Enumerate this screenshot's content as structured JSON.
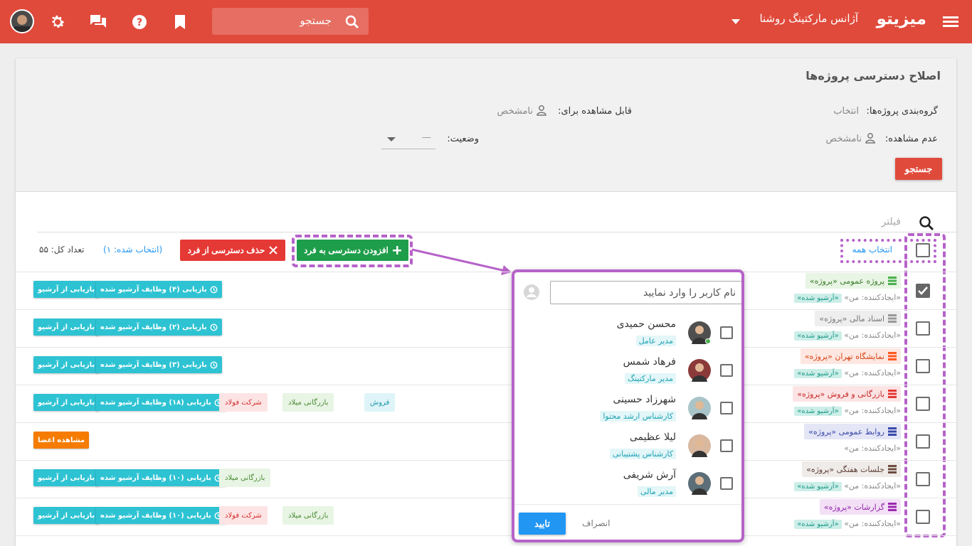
{
  "header": {
    "brand": "میزیتو",
    "agency": "آژانس مارکتینگ روشنا",
    "search_placeholder": "جستجو",
    "icons": [
      "menu-icon",
      "chevron-down-icon",
      "search-icon",
      "bookmark-icon",
      "help-icon",
      "chat-icon",
      "gear-icon",
      "avatar"
    ]
  },
  "filters": {
    "title": "اصلاح دسترسی پروژه‌ها",
    "grouping_label": "گروه‌بندی پروژه‌ها:",
    "grouping_value": "انتخاب",
    "viewable_label": "قابل مشاهده برای:",
    "viewable_value": "نامشخص",
    "not_viewable_label": "عدم مشاهده:",
    "not_viewable_value": "نامشخص",
    "status_label": "وضعیت:",
    "status_value": "—",
    "search_button": "جستجو"
  },
  "list": {
    "filter_placeholder": "فیلتر",
    "select_all": "انتخاب همه",
    "add_access": "افزودن دسترسی به فرد",
    "remove_access": "حذف دسترسی از فرد",
    "selected_count": "(انتخاب شده: ۱)",
    "total_count": "تعداد کل: ۵۵",
    "rows": [
      {
        "name": "پروژه عمومی «پروژه»",
        "creator": "«ایجادکننده: من»",
        "archived": "«آرشیو شده»",
        "btn1": "بازیابی از آرشیو",
        "btn2": "بازیابی (۴) وظایف آرشیو شده"
      },
      {
        "name": "اسناد مالی «پروژه»",
        "creator": "«ایجادکننده: من»",
        "archived": "«آرشیو شده»",
        "btn1": "بازیابی از آرشیو",
        "btn2": "بازیابی (۲) وظایف آرشیو شده"
      },
      {
        "name": "نمایشگاه تهران «پروژه»",
        "creator": "«ایجادکننده: من»",
        "archived": "«آرشیو شده»",
        "btn1": "بازیابی از آرشیو",
        "btn2": "بازیابی (۳) وظایف آرشیو شده"
      },
      {
        "name": "بازرگانی و فروش «پروژه»",
        "creator": "«ایجادکننده: من»",
        "archived": "«آرشیو شده»",
        "btn1": "بازیابی از آرشیو",
        "btn2": "بازیابی (۱۸) وظایف آرشیو شده",
        "tags": [
          "شرکت فولاد",
          "بازرگانی میلاد",
          "فروش"
        ]
      },
      {
        "name": "روابط عمومی «پروژه»",
        "creator": "«ایجادکننده: من»",
        "btn1": "مشاهده اعضا"
      },
      {
        "name": "جلسات هفتگی «پروژه»",
        "creator": "«ایجادکننده: من»",
        "archived": "«آرشیو شده»",
        "btn1": "بازیابی از آرشیو",
        "btn2": "بازیابی (۱۰) وظایف آرشیو شده",
        "tags": [
          "بازرگانی میلاد"
        ]
      },
      {
        "name": "گزارشات «پروژه»",
        "creator": "«ایجادکننده: من»",
        "archived": "«آرشیو شده»",
        "btn1": "بازیابی از آرشیو",
        "btn2": "بازیابی (۱۰) وظایف آرشیو شده",
        "tags": [
          "شرکت فولاد",
          "بازرگانی میلاد"
        ]
      }
    ]
  },
  "popup": {
    "input_placeholder": "نام کاربر را وارد نمایید",
    "users": [
      {
        "name": "محسن حمیدی",
        "role": "مدیر عامل"
      },
      {
        "name": "فرهاد شمس",
        "role": "مدیر مارکتینگ"
      },
      {
        "name": "شهرزاد حسینی",
        "role": "کارشناس ارشد محتوا"
      },
      {
        "name": "لیلا عظیمی",
        "role": "کارشناس پشتیبانی"
      },
      {
        "name": "آرش شریفی",
        "role": "مدیر مالی"
      }
    ],
    "confirm": "تایید",
    "cancel": "انصراف"
  },
  "colors": {
    "primary": "#e04a3b",
    "green": "#1e9e4a",
    "teal": "#2ec3d3",
    "highlight": "#b662c9",
    "blue": "#2196f3"
  }
}
